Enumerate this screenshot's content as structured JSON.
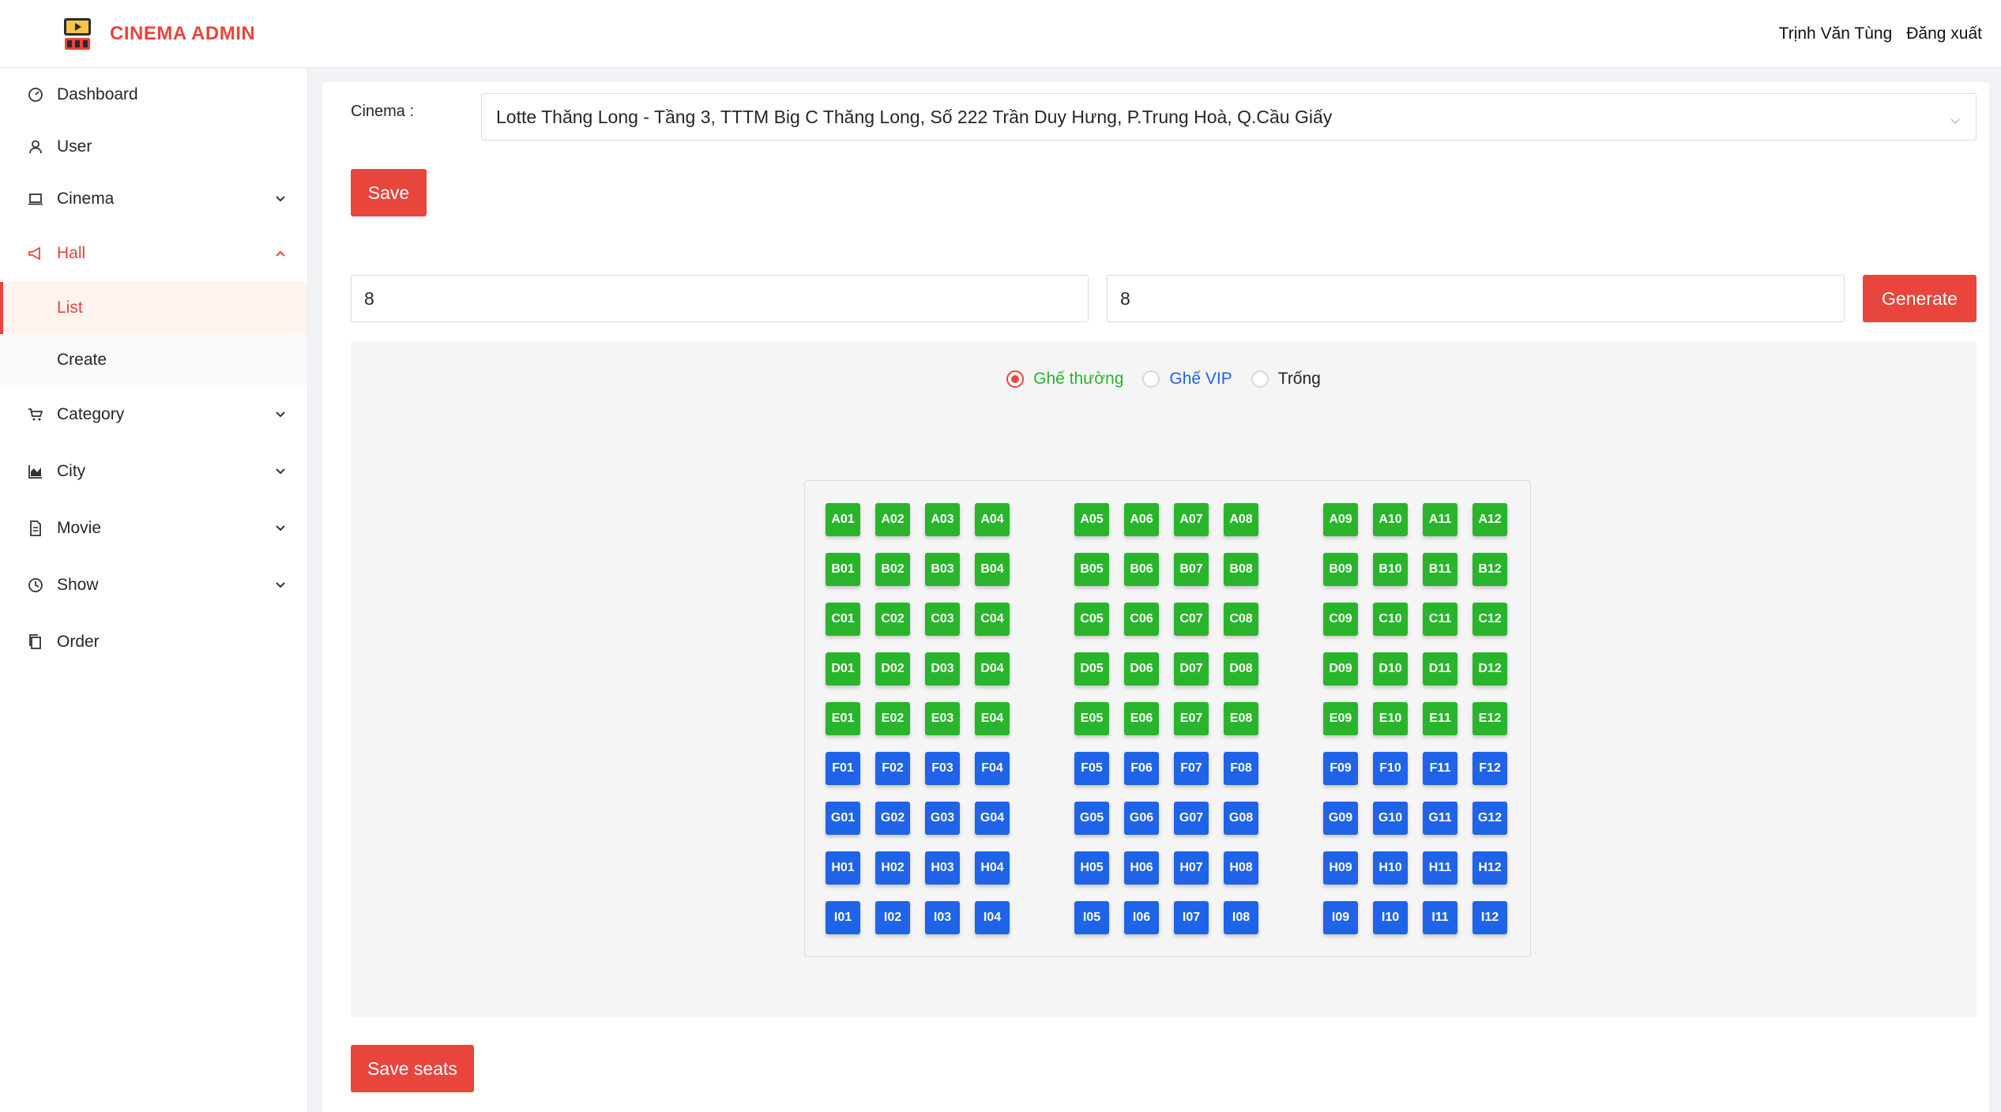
{
  "header": {
    "brand": "CINEMA ADMIN",
    "user_name": "Trịnh Văn Tùng",
    "logout": "Đăng xuất"
  },
  "sidebar": {
    "items": [
      {
        "label": "Dashboard",
        "icon": "dashboard-icon"
      },
      {
        "label": "User",
        "icon": "user-icon"
      },
      {
        "label": "Cinema",
        "icon": "laptop-icon",
        "expandable": true
      },
      {
        "label": "Hall",
        "icon": "notification-icon",
        "expandable": true,
        "expanded": true
      },
      {
        "label": "Category",
        "icon": "cart-icon",
        "expandable": true
      },
      {
        "label": "City",
        "icon": "area-chart-icon",
        "expandable": true
      },
      {
        "label": "Movie",
        "icon": "file-icon",
        "expandable": true
      },
      {
        "label": "Show",
        "icon": "clock-icon",
        "expandable": true
      },
      {
        "label": "Order",
        "icon": "copy-icon"
      }
    ],
    "hall_submenu": [
      "List",
      "Create"
    ],
    "selected": "List"
  },
  "form": {
    "cinema_label": "Cinema",
    "cinema_value": "Lotte Thăng Long - Tầng 3, TTTM Big C Thăng Long, Số 222 Trần Duy Hưng, P.Trung Hoà, Q.Cầu Giấy",
    "save_label": "Save",
    "rows_value": "8",
    "cols_value": "8",
    "generate_label": "Generate",
    "save_seats_label": "Save seats"
  },
  "seat_types": {
    "normal": {
      "label": "Ghế thường",
      "color": "#28b52b",
      "checked": true
    },
    "vip": {
      "label": "Ghế VIP",
      "color": "#1e63e8",
      "checked": false
    },
    "empty": {
      "label": "Trống",
      "checked": false
    }
  },
  "seat_map": {
    "rows": [
      "A",
      "B",
      "C",
      "D",
      "E",
      "F",
      "G",
      "H",
      "I"
    ],
    "seats_per_row": 12,
    "block_size": 4,
    "normal_rows": [
      "A",
      "B",
      "C",
      "D",
      "E"
    ],
    "vip_rows": [
      "F",
      "G",
      "H",
      "I"
    ]
  },
  "colors": {
    "accent": "#e8453c",
    "normal_seat": "#28b52b",
    "vip_seat": "#1e63e8"
  }
}
